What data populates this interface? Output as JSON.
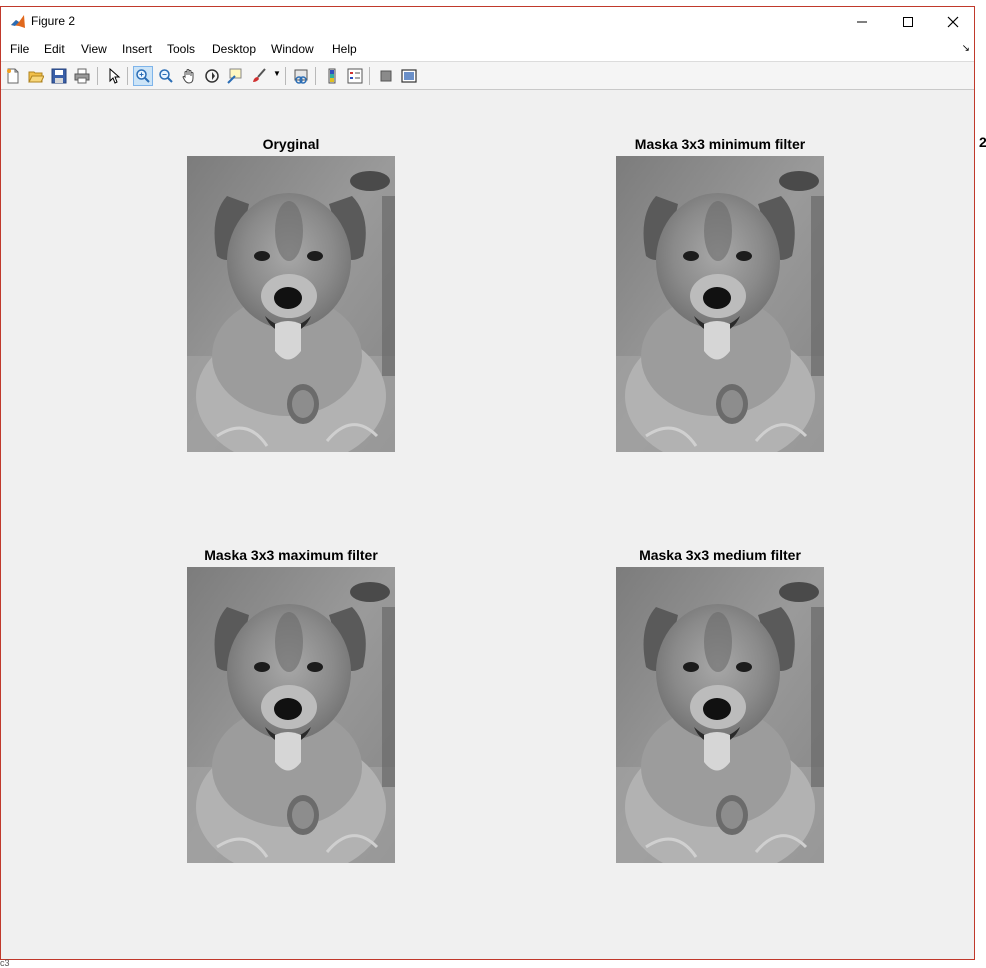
{
  "window": {
    "title": "Figure 2"
  },
  "menu": {
    "items": [
      "File",
      "Edit",
      "View",
      "Insert",
      "Tools",
      "Desktop",
      "Window",
      "Help"
    ]
  },
  "toolbar": {
    "buttons": [
      "new-figure-icon",
      "open-icon",
      "save-icon",
      "print-icon",
      "select-arrow-icon",
      "zoom-in-icon",
      "zoom-out-icon",
      "pan-hand-icon",
      "rotate-3d-icon",
      "data-cursor-icon",
      "brush-icon",
      "link-plot-icon",
      "colorbar-icon",
      "legend-icon",
      "hide-plot-tools-icon",
      "show-plot-tools-icon"
    ],
    "active": "zoom-in-icon"
  },
  "subplots": [
    {
      "title": "Oryginal",
      "image": "grayscale-dog-photo"
    },
    {
      "title": "Maska 3x3 minimum filter",
      "image": "grayscale-dog-photo"
    },
    {
      "title": "Maska 3x3 maximum filter",
      "image": "grayscale-dog-photo"
    },
    {
      "title": "Maska 3x3 medium filter",
      "image": "grayscale-dog-photo"
    }
  ],
  "edge_texts": {
    "right_partial": "2",
    "bottom_partial": "c3"
  },
  "colors": {
    "window_border": "#c0392b",
    "figure_background": "#f0f0f0"
  }
}
